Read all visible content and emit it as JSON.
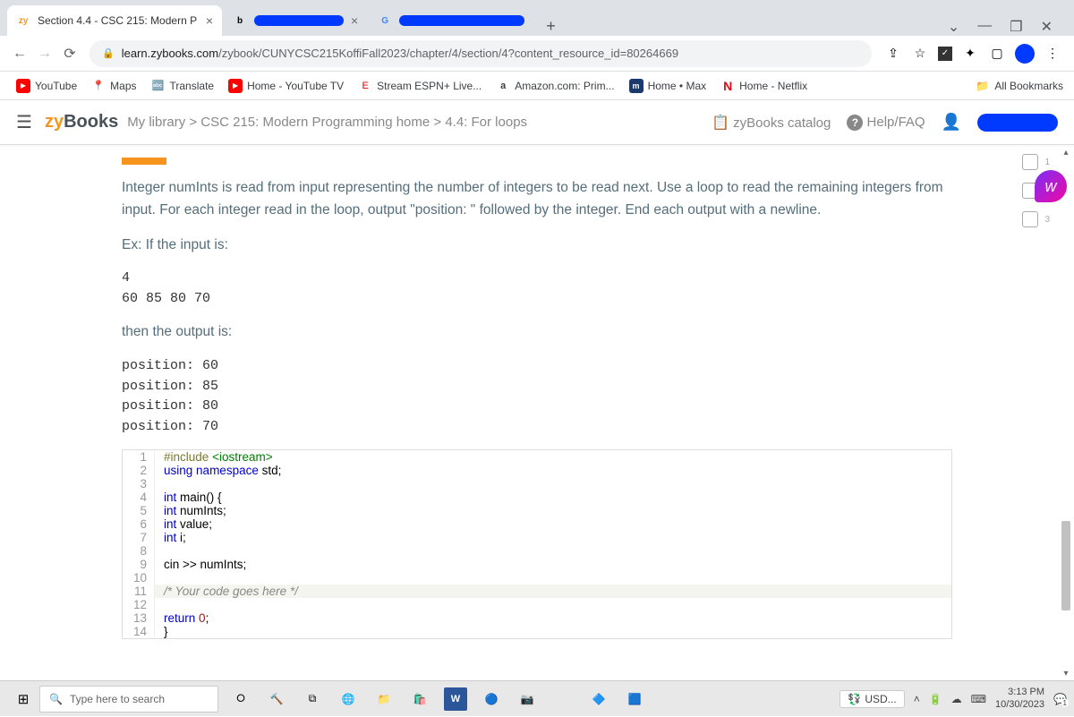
{
  "browser": {
    "tab_title": "Section 4.4 - CSC 215: Modern P",
    "tab_favicon": "zy",
    "url_domain": "learn.zybooks.com",
    "url_path": "/zybook/CUNYCSC215KoffiFall2023/chapter/4/section/4?content_resource_id=80264669",
    "bookmarks": [
      "YouTube",
      "Maps",
      "Translate",
      "Home - YouTube TV",
      "Stream ESPN+ Live...",
      "Amazon.com: Prim...",
      "Home • Max",
      "Home - Netflix"
    ],
    "all_bookmarks": "All Bookmarks"
  },
  "zybooks": {
    "logo_zy": "zy",
    "logo_books": "Books",
    "breadcrumb": "My library > CSC 215: Modern Programming home > 4.4: For loops",
    "catalog": "zyBooks catalog",
    "help": "Help/FAQ"
  },
  "problem": {
    "text1": "Integer numInts is read from input representing the number of integers to be read next. Use a loop to read the remaining integers from input. For each integer read in the loop, output \"position: \" followed by the integer. End each output with a newline.",
    "example_label": "Ex: If the input is:",
    "example_input": "4\n60 85 80 70",
    "then_label": "then the output is:",
    "example_output": "position: 60\nposition: 85\nposition: 80\nposition: 70"
  },
  "code": {
    "lines": [
      {
        "n": 1,
        "html": "<span class='kw-pre'>#include</span> <span class='kw-inc'>&lt;iostream&gt;</span>"
      },
      {
        "n": 2,
        "html": "<span class='kw-blue'>using</span> <span class='kw-blue'>namespace</span> std;"
      },
      {
        "n": 3,
        "html": ""
      },
      {
        "n": 4,
        "html": "<span class='kw-blue'>int</span> main() {"
      },
      {
        "n": 5,
        "html": "   <span class='kw-blue'>int</span> numInts;"
      },
      {
        "n": 6,
        "html": "   <span class='kw-blue'>int</span> value;"
      },
      {
        "n": 7,
        "html": "   <span class='kw-blue'>int</span> i;"
      },
      {
        "n": 8,
        "html": ""
      },
      {
        "n": 9,
        "html": "   cin &gt;&gt; numInts;"
      },
      {
        "n": 10,
        "html": ""
      },
      {
        "n": 11,
        "html": "   <span class='kw-str'>/* Your code goes here */</span>",
        "hl": true
      },
      {
        "n": 12,
        "html": ""
      },
      {
        "n": 13,
        "html": "   <span class='kw-blue'>return</span> <span class='kw-num'>0</span>;"
      },
      {
        "n": 14,
        "html": "}"
      }
    ]
  },
  "steps": [
    "1",
    "2",
    "3"
  ],
  "taskbar": {
    "search_placeholder": "Type here to search",
    "currency": "USD...",
    "time": "3:13 PM",
    "date": "10/30/2023",
    "notif_count": "1"
  }
}
